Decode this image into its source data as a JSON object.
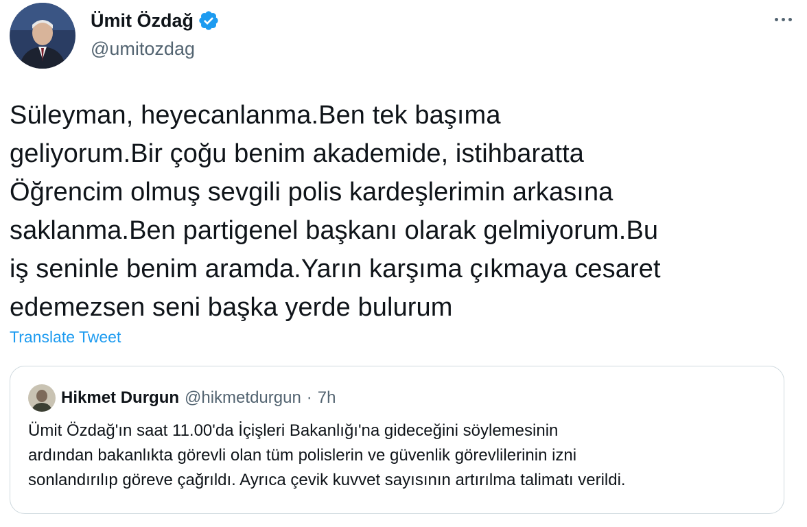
{
  "author": {
    "display_name": "Ümit Özdağ",
    "handle": "@umitozdag",
    "verified": true
  },
  "tweet": {
    "text": "Süleyman, heyecanlanma.Ben tek başıma\ngeliyorum.Bir çoğu benim akademide, istihbaratta\nÖğrencim olmuş sevgili polis kardeşlerimin arkasına\nsaklanma.Ben partigenel başkanı olarak gelmiyorum.Bu\niş seninle benim aramda.Yarın karşıma çıkmaya cesaret\nedemezsen seni başka yerde bulurum",
    "translate_label": "Translate Tweet"
  },
  "quoted_tweet": {
    "display_name": "Hikmet Durgun",
    "handle": "@hikmetdurgun",
    "separator": "·",
    "time": "7h",
    "text": "Ümit Özdağ'ın saat 11.00'da İçişleri Bakanlığı'na gideceğini söylemesinin\nardından bakanlıkta görevli olan tüm polislerin ve güvenlik görevlilerinin izni\nsonlandırılıp göreve çağrıldı. Ayrıca çevik kuvvet sayısının artırılma talimatı verildi."
  },
  "icons": {
    "verified": "verified-badge-icon",
    "more": "more-options-icon"
  },
  "colors": {
    "accent": "#1d9bf0",
    "text": "#0f1419",
    "secondary_text": "#536471",
    "border": "#cfd9de"
  }
}
